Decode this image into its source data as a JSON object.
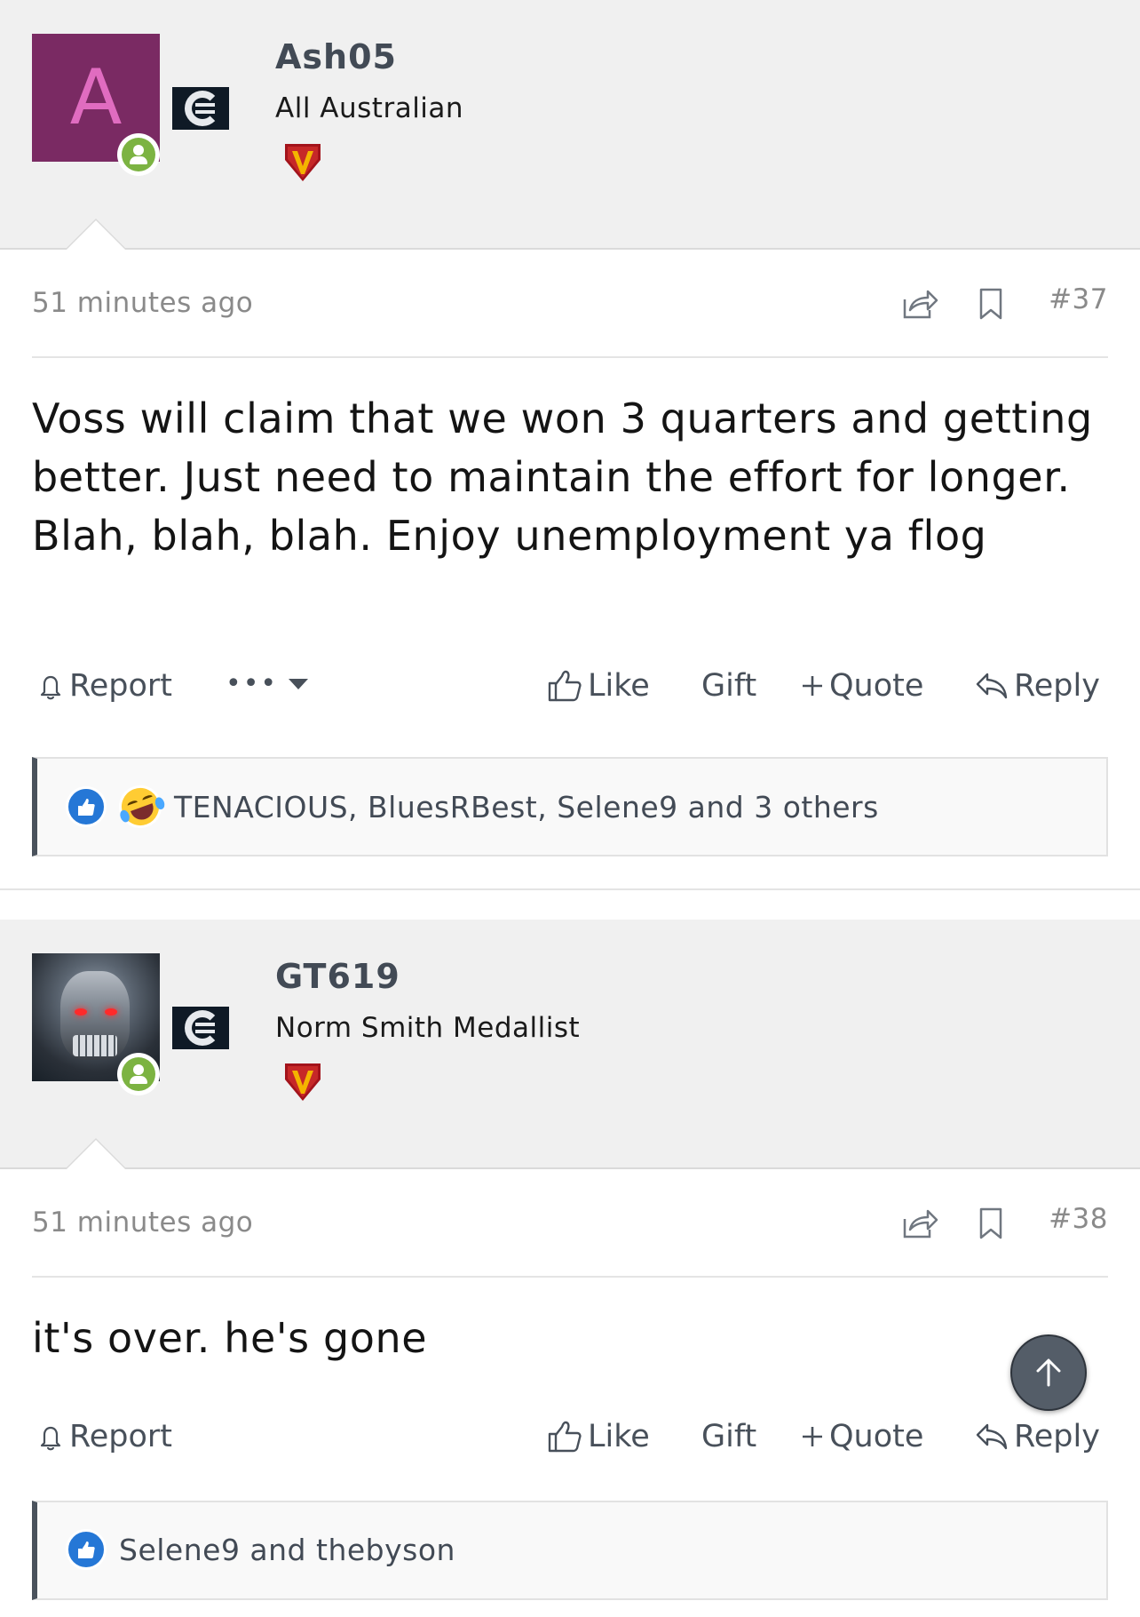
{
  "posts": [
    {
      "avatar_letter": "A",
      "avatar_color": "#7a2a63",
      "username": "Ash05",
      "user_title": "All Australian",
      "time": "51 minutes ago",
      "post_number": "#37",
      "body": "Voss will claim that we won 3 quarters and getting better. Just need to maintain the effort for longer. Blah, blah, blah. Enjoy unemployment ya flog",
      "actions": {
        "report": "Report",
        "more": "•••",
        "like": "Like",
        "gift": "Gift",
        "quote": "Quote",
        "reply": "Reply"
      },
      "reactions_text": "TENACIOUS, BluesRBest, Selene9 and 3 others",
      "reaction_icons": [
        "like-reaction",
        "laugh-reaction"
      ]
    },
    {
      "avatar_letter": "",
      "username": "GT619",
      "user_title": "Norm Smith Medallist",
      "time": "51 minutes ago",
      "post_number": "#38",
      "body": "it's over. he's gone",
      "actions": {
        "report": "Report",
        "like": "Like",
        "gift": "Gift",
        "quote": "Quote",
        "reply": "Reply"
      },
      "reactions_text": "Selene9 and thebyson",
      "reaction_icons": [
        "like-reaction"
      ]
    }
  ],
  "colors": {
    "header_bg": "#f0f0f0",
    "online": "#7cb342",
    "accent_text": "#424a55",
    "badge": "#a3131b"
  }
}
